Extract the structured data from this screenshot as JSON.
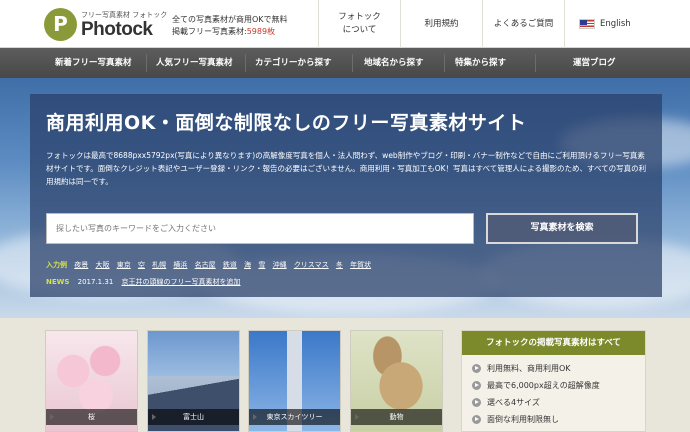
{
  "header": {
    "logo_mark": "P",
    "logo_sub": "フリー写真素材 フォトック",
    "logo_name": "Photock",
    "tagline_line1": "全ての写真素材が商用OKで無料",
    "tagline_line2_prefix": "掲載フリー写真素材:",
    "tagline_count": "5989枚",
    "nav": [
      {
        "line1": "フォトック",
        "line2": "について"
      },
      {
        "line1": "利用規約",
        "line2": ""
      },
      {
        "line1": "よくあるご質問",
        "line2": ""
      },
      {
        "line1": "English",
        "line2": ""
      }
    ]
  },
  "catnav": [
    "新着フリー写真素材",
    "人気フリー写真素材",
    "カテゴリーから探す",
    "地域名から探す",
    "特集から探す",
    "運営ブログ"
  ],
  "hero": {
    "title": "商用利用OK・面倒な制限なしのフリー写真素材サイト",
    "desc": "フォトックは最高で8688pxx5792px(写真により異なります)の高解像度写真を個人・法人問わず、web制作やブログ・印刷・バナー制作などで自由にご利用頂けるフリー写真素材サイトです。面倒なクレジット表記やユーザー登録・リンク・報告の必要はございません。商用利用・写真加工もOK！写真はすべて管理人による撮影のため、すべての写真の利用規約は同一です。",
    "search_placeholder": "探したい写真のキーワードをご入力ください",
    "search_button": "写真素材を検索",
    "tags_label": "入力例",
    "tags": [
      "夜景",
      "大阪",
      "東京",
      "空",
      "札幌",
      "横浜",
      "名古屋",
      "鉄道",
      "海",
      "雪",
      "沖縄",
      "クリスマス",
      "冬",
      "年賀状"
    ],
    "news_label": "NEWS",
    "news_date": "2017.1.31",
    "news_text": "京王井の頭線のフリー写真素材を追加"
  },
  "thumbs": [
    "桜",
    "富士山",
    "東京スカイツリー",
    "動物"
  ],
  "sidebox": {
    "title": "フォトックの掲載写真素材はすべて",
    "items": [
      "利用無料、商用利用OK",
      "最高で6,000px超えの超解像度",
      "選べる4サイズ",
      "面倒な利用制限無し"
    ]
  }
}
